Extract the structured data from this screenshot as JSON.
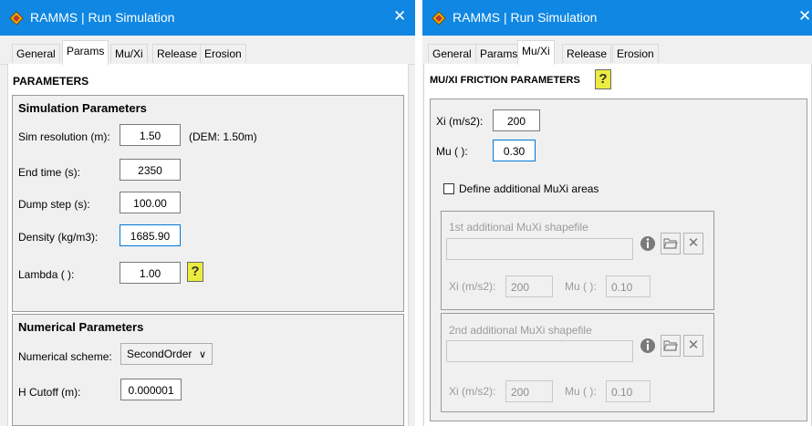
{
  "left_window": {
    "title": "RAMMS | Run Simulation",
    "close": "✕",
    "tabs": [
      "General",
      "Params",
      "Mu/Xi",
      "Release",
      "Erosion"
    ],
    "heading": "PARAMETERS",
    "sim_group": {
      "title": "Simulation Parameters",
      "sim_res_label": "Sim resolution (m):",
      "sim_res_value": "1.50",
      "dem_note": "(DEM: 1.50m)",
      "end_time_label": "End time (s):",
      "end_time_value": "2350",
      "dump_label": "Dump step (s):",
      "dump_value": "100.00",
      "density_label": "Density (kg/m3):",
      "density_value": "1685.90",
      "lambda_label": "Lambda ( ):",
      "lambda_value": "1.00",
      "help_glyph": "?"
    },
    "num_group": {
      "title": "Numerical Parameters",
      "scheme_label": "Numerical scheme:",
      "scheme_value": "SecondOrder",
      "cutoff_label": "H Cutoff (m):",
      "cutoff_value": "0.000001"
    }
  },
  "right_window": {
    "title": "RAMMS | Run Simulation",
    "close": "✕",
    "tabs": [
      "General",
      "Params",
      "Mu/Xi",
      "Release",
      "Erosion"
    ],
    "heading": "MU/XI FRICTION PARAMETERS",
    "help_glyph": "?",
    "xi_label": "Xi (m/s2):",
    "xi_value": "200",
    "mu_label": "Mu ( ):",
    "mu_value": "0.30",
    "define_label": "Define additional MuXi areas",
    "define_checked": false,
    "areas": [
      {
        "title": "1st additional MuXi shapefile",
        "xi_label": "Xi (m/s2):",
        "xi_value": "200",
        "mu_label": "Mu ( ):",
        "mu_value": "0.10"
      },
      {
        "title": "2nd additional MuXi shapefile",
        "xi_label": "Xi (m/s2):",
        "xi_value": "200",
        "mu_label": "Mu ( ):",
        "mu_value": "0.10"
      }
    ]
  },
  "colors": {
    "titlebar": "#0f87e3",
    "focus_border": "#0078d7",
    "help_button": "#ecec40"
  }
}
